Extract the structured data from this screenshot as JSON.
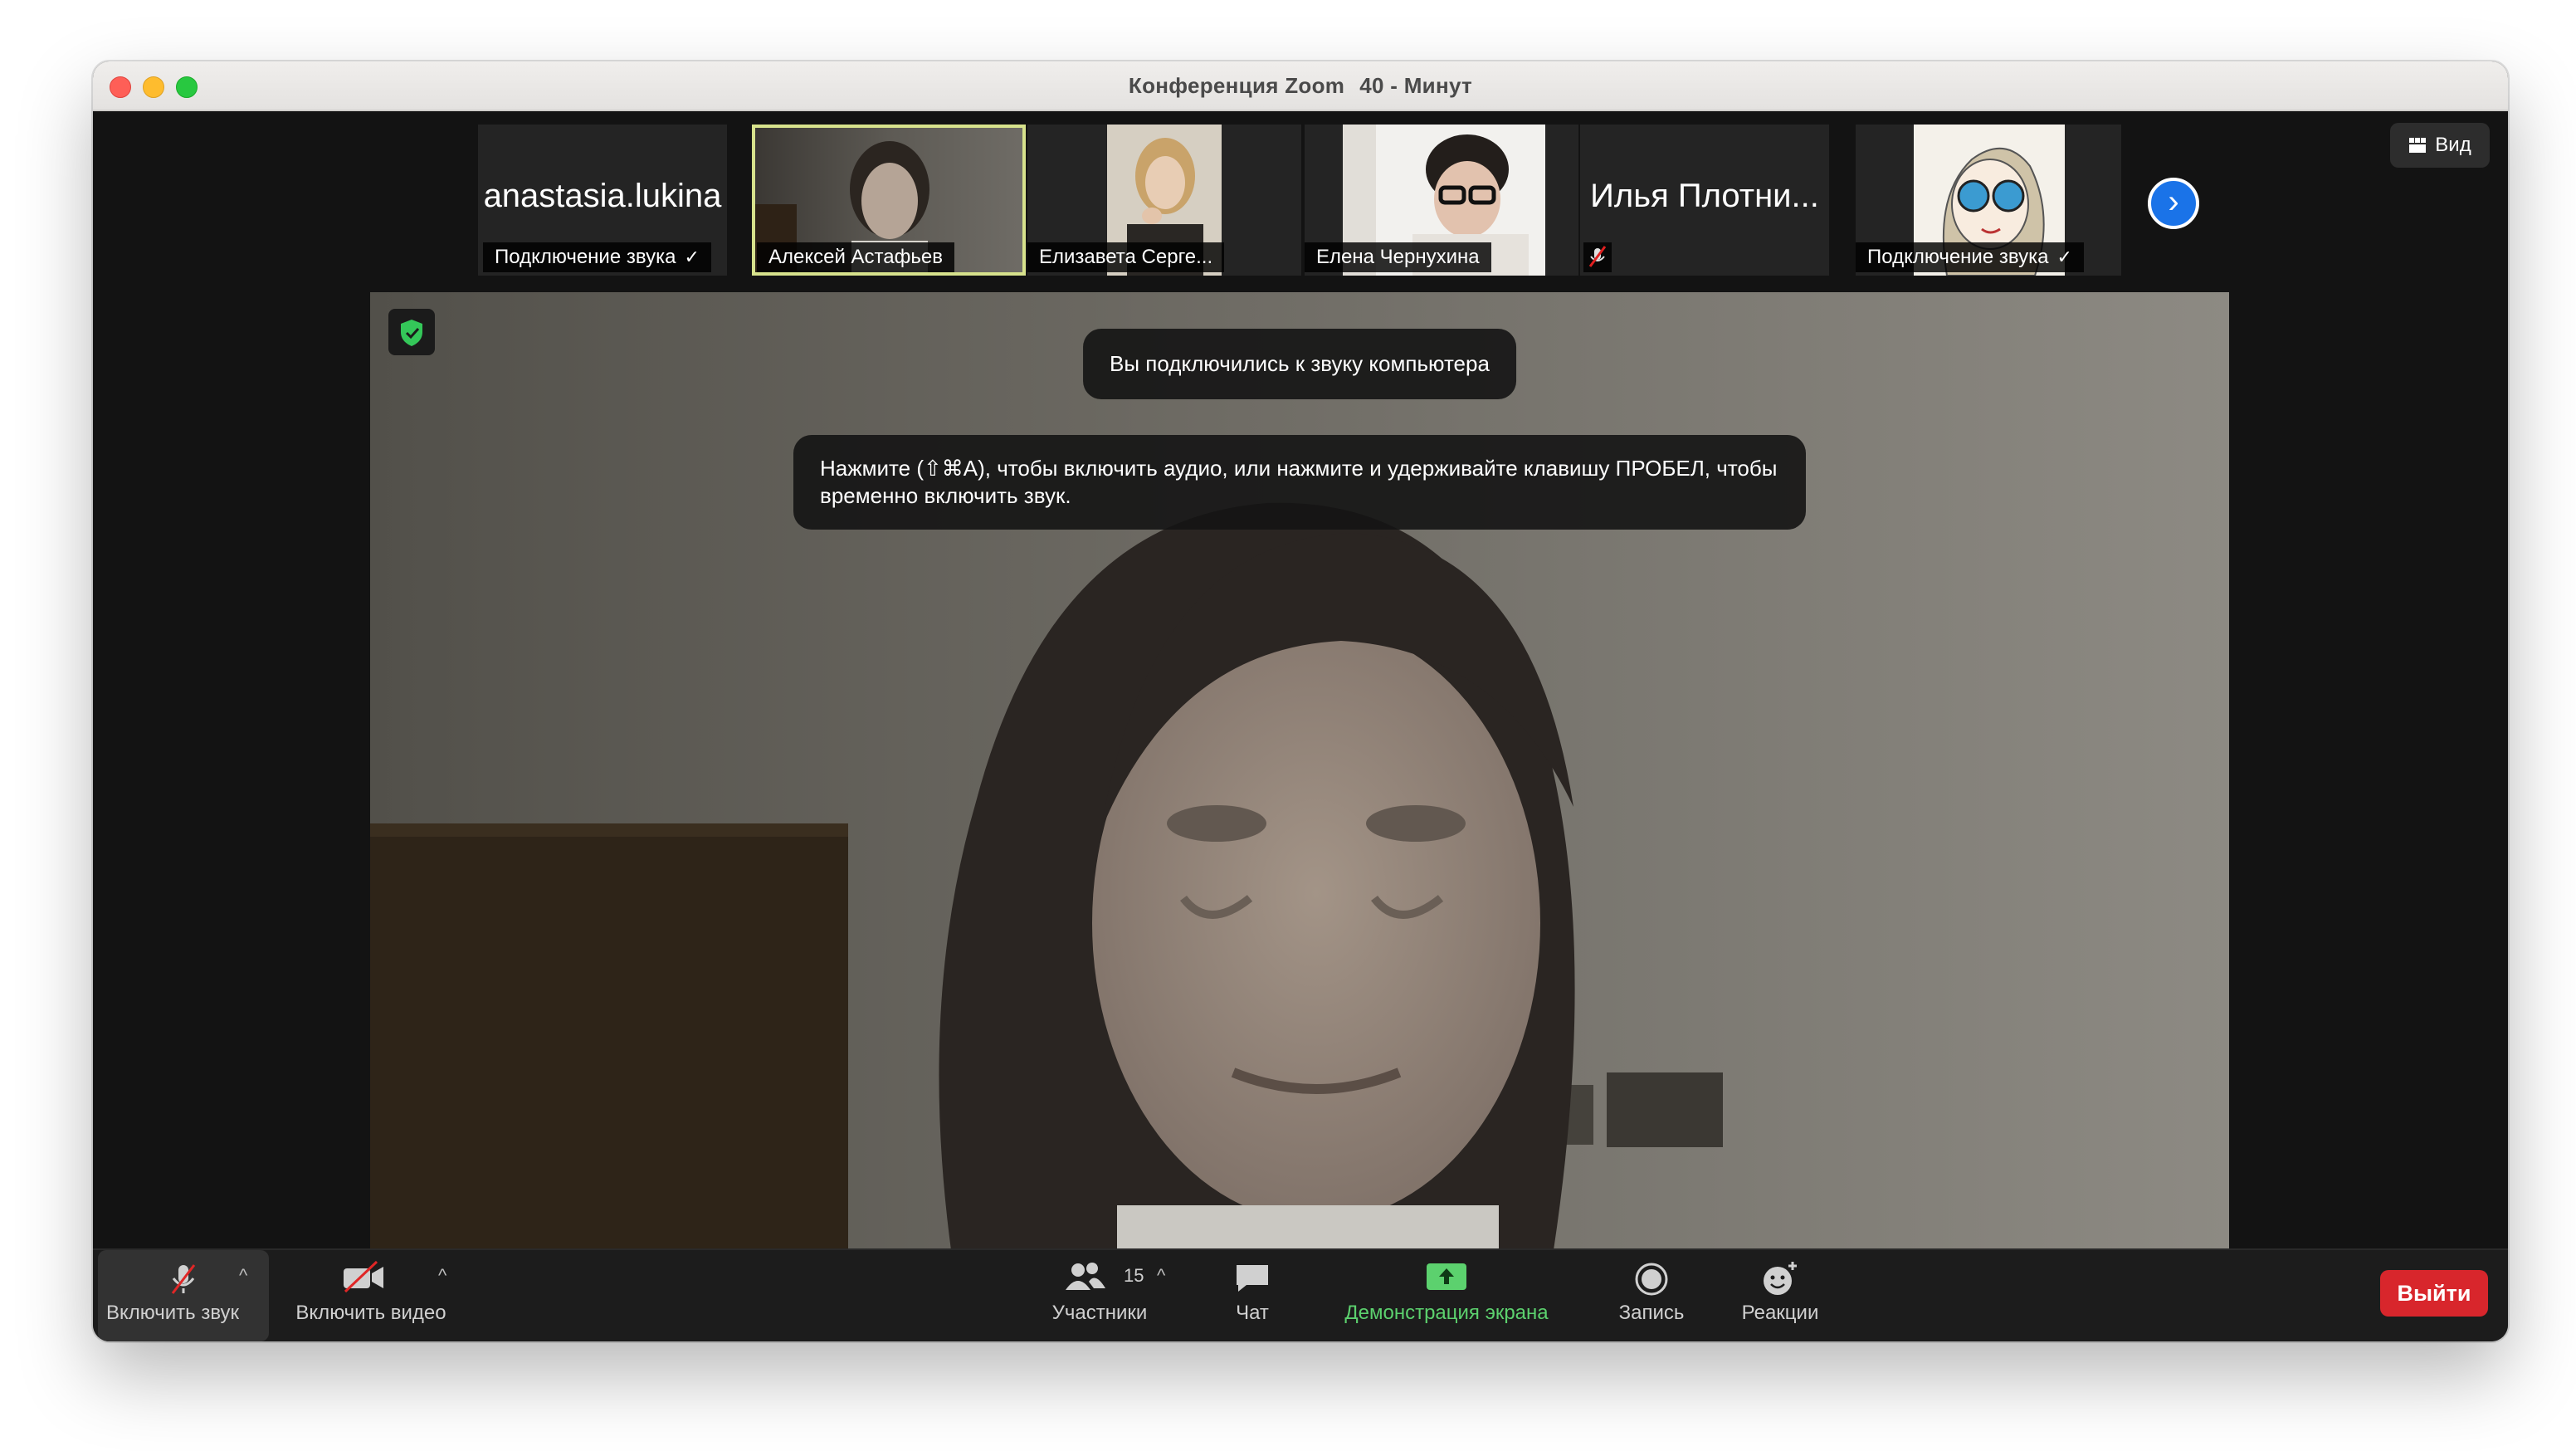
{
  "window": {
    "title": "Конференция Zoom",
    "timer": "40 - Минут"
  },
  "header": {
    "view_label": "Вид"
  },
  "gallery": {
    "tiles": [
      {
        "name": "anastasia.lukina",
        "caption": "Подключение звука",
        "caption_check": "✓"
      },
      {
        "caption": "Алексей Астафьев"
      },
      {
        "caption": "Елизавета Серге..."
      },
      {
        "caption": "Елена Чернухина"
      },
      {
        "name": "Илья Плотни..."
      },
      {
        "caption": "Подключение звука",
        "caption_check": "✓"
      }
    ],
    "next_page_icon": "chevron-right-icon"
  },
  "notifications": {
    "audio_connected": "Вы подключились к звуку компьютера",
    "unmute_hint": "Нажмите  (⇧⌘A), чтобы включить аудио, или нажмите и удерживайте клавишу ПРОБЕЛ, чтобы временно включить звук."
  },
  "toolbar": {
    "unmute_label": "Включить звук",
    "start_video_label": "Включить видео",
    "participants_label": "Участники",
    "participants_count": "15",
    "chat_label": "Чат",
    "share_label": "Демонстрация экрана",
    "record_label": "Запись",
    "reactions_label": "Реакции",
    "leave_label": "Выйти"
  },
  "colors": {
    "share_accent": "#5cd16e",
    "leave_button": "#d8262c",
    "active_speaker_border": "#d7e28c",
    "next_page_button": "#1a73e8"
  }
}
